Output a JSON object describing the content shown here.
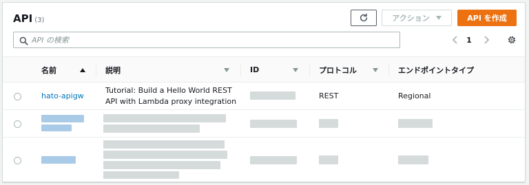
{
  "header": {
    "title": "API",
    "count": "(3)",
    "actions_label": "アクション",
    "create_label": "API を作成"
  },
  "search": {
    "placeholder": "API の検索",
    "value": ""
  },
  "pagination": {
    "current_page": "1"
  },
  "table": {
    "columns": [
      {
        "label": "名前",
        "sort": "ascending"
      },
      {
        "label": "説明",
        "sort": "none"
      },
      {
        "label": "ID",
        "sort": "none"
      },
      {
        "label": "プロトコル",
        "sort": "none"
      },
      {
        "label": "エンドポイントタイプ",
        "sort": "none"
      }
    ],
    "rows": [
      {
        "name": "hato-apigw",
        "description_line1": "Tutorial: Build a Hello World REST",
        "description_line2": "API with Lambda proxy integration",
        "id": "",
        "protocol": "REST",
        "endpoint_type": "Regional",
        "redacted": false
      },
      {
        "name": "",
        "description_line1": "",
        "description_line2": "",
        "id": "",
        "protocol": "",
        "endpoint_type": "",
        "redacted": true
      },
      {
        "name": "",
        "description_line1": "",
        "description_line2": "",
        "id": "",
        "protocol": "",
        "endpoint_type": "",
        "redacted": true
      }
    ]
  },
  "colors": {
    "primary_button": "#ec7211",
    "link": "#0073bb",
    "border": "#eaeded",
    "text": "#16191f"
  },
  "icons": {
    "refresh": "refresh-icon",
    "search": "search-icon",
    "prev": "chevron-left-icon",
    "next": "chevron-right-icon",
    "settings": "gear-icon",
    "actions_caret": "caret-down-icon"
  }
}
